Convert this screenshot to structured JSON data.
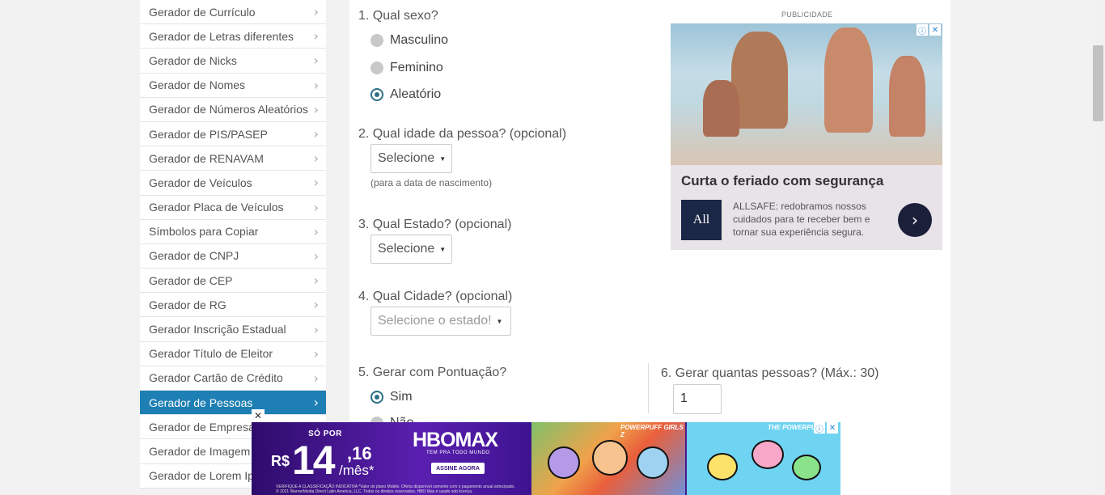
{
  "sidebar": {
    "items": [
      {
        "label": "Gerador de Currículo"
      },
      {
        "label": "Gerador de Letras diferentes"
      },
      {
        "label": "Gerador de Nicks"
      },
      {
        "label": "Gerador de Nomes"
      },
      {
        "label": "Gerador de Números Aleatórios"
      },
      {
        "label": "Gerador de PIS/PASEP"
      },
      {
        "label": "Gerador de RENAVAM"
      },
      {
        "label": "Gerador de Veículos"
      },
      {
        "label": "Gerador Placa de Veículos"
      },
      {
        "label": "Símbolos para Copiar"
      },
      {
        "label": "Gerador de CNPJ"
      },
      {
        "label": "Gerador de CEP"
      },
      {
        "label": "Gerador de RG"
      },
      {
        "label": "Gerador Inscrição Estadual"
      },
      {
        "label": "Gerador Título de Eleitor"
      },
      {
        "label": "Gerador Cartão de Crédito"
      },
      {
        "label": "Gerador de Pessoas",
        "active": true
      },
      {
        "label": "Gerador de Empresa"
      },
      {
        "label": "Gerador de Imagem"
      },
      {
        "label": "Gerador de Lorem Ip"
      }
    ],
    "chevron": "›"
  },
  "form": {
    "q1": {
      "label": "1. Qual sexo?",
      "options": [
        "Masculino",
        "Feminino",
        "Aleatório"
      ],
      "selected": "Aleatório"
    },
    "q2": {
      "label": "2. Qual idade da pessoa? (opcional)",
      "select": "Selecione",
      "hint": "(para a data de nascimento)"
    },
    "q3": {
      "label": "3. Qual Estado? (opcional)",
      "select": "Selecione"
    },
    "q4": {
      "label": "4. Qual Cidade? (opcional)",
      "select": "Selecione o estado!"
    },
    "q5": {
      "label": "5. Gerar com Pontuação?",
      "options": [
        "Sim",
        "Não"
      ],
      "selected": "Sim"
    },
    "q6": {
      "label": "6. Gerar quantas pessoas? (Máx.: 30)",
      "value": "1"
    }
  },
  "ad": {
    "label": "PUBLICIDADE",
    "title": "Curta o feriado com segurança",
    "logo": "All",
    "text": "ALLSAFE: redobramos nossos cuidados para te receber bem e tornar sua experiência segura.",
    "go": "›",
    "icons": {
      "info": "ⓘ",
      "close": "✕"
    }
  },
  "banner": {
    "sopor": "SÓ POR",
    "currency": "R$",
    "price": "14",
    "cents": ",16",
    "per": "/mês*",
    "brand": "HBOMAX",
    "tagline": "TEM PRA TODO MUNDO",
    "cta": "ASSINE AGORA",
    "fine": "VERIFIQUE A CLASSIFICAÇÃO INDICATIVA *Valor do plano Mobile. Oferta disponível somente com o pagamento anual antecipado. © 2021 WarnerMedia Direct Latin America, LLC. Todos os direitos reservados. HBO Max é usado sob licença.",
    "show1": "POWERPUFF GIRLS Z",
    "show2": "THE POWERPUFF",
    "close": "✕",
    "info": "ⓘ"
  }
}
